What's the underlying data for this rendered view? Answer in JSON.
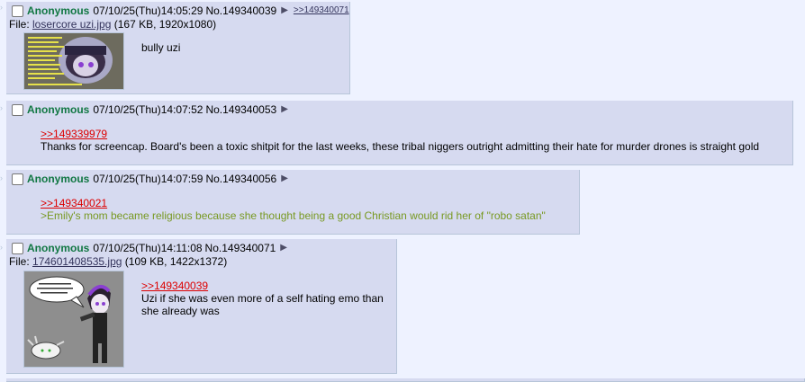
{
  "posts": [
    {
      "name": "Anonymous",
      "date": "07/10/25(Thu)14:05:29",
      "number": "No.149340039",
      "reply_link": ">>149340071",
      "file_label": "File:",
      "file_name": "losercore uzi.jpg",
      "file_meta": "(167 KB, 1920x1080)",
      "text": "bully uzi"
    },
    {
      "name": "Anonymous",
      "date": "07/10/25(Thu)14:07:52",
      "number": "No.149340053",
      "quote": ">>149339979",
      "text": "Thanks for screencap. Board's been a toxic shitpit for the last weeks, these tribal niggers outright admitting their hate for murder drones is straight gold"
    },
    {
      "name": "Anonymous",
      "date": "07/10/25(Thu)14:07:59",
      "number": "No.149340056",
      "quote": ">>149340021",
      "greentext": ">Emily's mom became religious because she thought being a good Christian would rid her of \"robo satan\""
    },
    {
      "name": "Anonymous",
      "date": "07/10/25(Thu)14:11:08",
      "number": "No.149340071",
      "file_label": "File:",
      "file_name": "174601408535.jpg",
      "file_meta": "(109 KB, 1422x1372)",
      "quote": ">>149340039",
      "text": "Uzi if she was even more of a self hating emo than she already was"
    }
  ],
  "icons": {
    "menu": "triangle-right-icon",
    "side": "double-arrow-icon"
  },
  "colors": {
    "background": "#eef2ff",
    "post_bg": "#d6daf0",
    "name": "#117743",
    "quote": "#dd0000",
    "greentext": "#789922"
  }
}
